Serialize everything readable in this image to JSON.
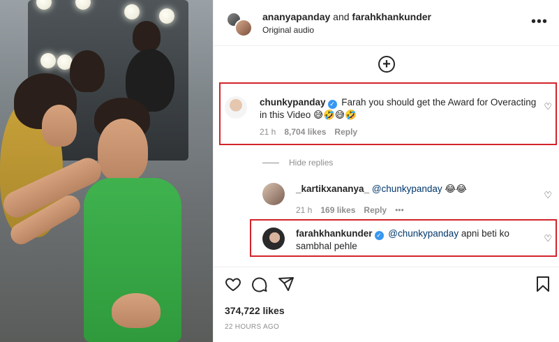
{
  "header": {
    "user1": "ananyapanday",
    "connector": " and ",
    "user2": "farahkhankunder",
    "audio": "Original audio",
    "more": "•••"
  },
  "comments": [
    {
      "username": "chunkypanday",
      "text": "Farah you should get the Award for Overacting in this Video 😅🤣😅🤣",
      "time": "21 h",
      "likes": "8,704 likes",
      "reply": "Reply"
    }
  ],
  "hide_replies": "Hide replies",
  "replies": [
    {
      "username": "_kartikxananya_",
      "mention": "@chunkypanday",
      "text": " 😂😂",
      "time": "21 h",
      "likes": "169 likes",
      "reply": "Reply",
      "more": "•••"
    },
    {
      "username": "farahkhankunder",
      "mention": "@chunkypanday",
      "text": " apni beti ko sambhal pehle"
    }
  ],
  "post": {
    "like_count": "374,722 likes",
    "timestamp": "22 HOURS AGO"
  },
  "colors": {
    "highlight": "#d2232a",
    "verified": "#3897f0",
    "mention": "#00376b",
    "muted": "#8e8e8e"
  }
}
